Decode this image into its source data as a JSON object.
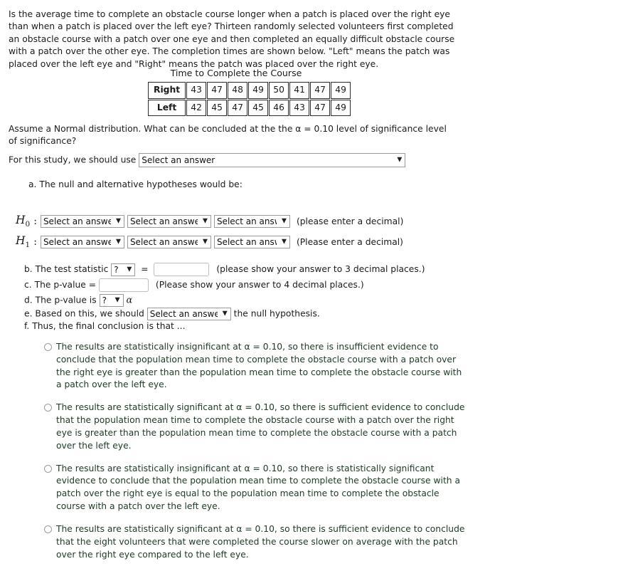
{
  "question": {
    "intro": "Is the average time to complete an obstacle course longer when a patch is placed over the right eye than when a patch is placed over the left eye? Thirteen randomly selected volunteers first completed an obstacle course with a patch over one eye and then completed an equally difficult obstacle course with a patch over the other eye. The completion times are shown below. \"Left\" means the patch was placed over the left eye and \"Right\" means the patch was placed over the right eye.",
    "assume": "Assume a Normal distribution.  What can be concluded at the the α = 0.10 level of significance level of significance?"
  },
  "table": {
    "title": "Time to Complete the Course",
    "rows": [
      {
        "label": "Right",
        "values": [
          "43",
          "47",
          "48",
          "49",
          "50",
          "41",
          "47",
          "49"
        ]
      },
      {
        "label": "Left",
        "values": [
          "42",
          "45",
          "47",
          "45",
          "46",
          "43",
          "47",
          "49"
        ]
      }
    ]
  },
  "study": {
    "prompt": "For this study, we should use",
    "select_value": "Select an answer"
  },
  "part_a": {
    "label": "a. The null and alternative hypotheses would be:",
    "h0": {
      "symbol": "H",
      "subscript": "0",
      "colon": ":",
      "select1": "Select an answer",
      "select2": "Select an answer",
      "select3": "Select an answer",
      "note": "(please enter a decimal)"
    },
    "h1": {
      "symbol": "H",
      "subscript": "1",
      "colon": ":",
      "select1": "Select an answer",
      "select2": "Select an answer",
      "select3": "Select an answer",
      "note": "(Please enter a decimal)"
    }
  },
  "part_b": {
    "label": "b. The test statistic",
    "select_value": "?",
    "equals": "=",
    "input_value": "",
    "input_placeholder": "",
    "note": "(please show your answer to 3 decimal places.)"
  },
  "part_c": {
    "label": "c. The p-value =",
    "input_value": "",
    "input_placeholder": "",
    "note": "(Please show your answer to 4 decimal places.)"
  },
  "part_d": {
    "label": "d. The p-value is",
    "select_value": "?",
    "alpha": "α"
  },
  "part_e": {
    "label_before": "e. Based on this, we should",
    "select_value": "Select an answer",
    "label_after": "the null hypothesis."
  },
  "part_f": {
    "label": "f. Thus, the final conclusion is that ..."
  },
  "options": [
    {
      "id": "option-1",
      "selected": false,
      "text": "The results are statistically insignificant at α = 0.10, so there is insufficient evidence to conclude that the population mean time to complete the obstacle course with a patch over the right eye is greater than the population mean time to complete the obstacle course with a patch over the left eye."
    },
    {
      "id": "option-2",
      "selected": false,
      "text": "The results are statistically significant at α = 0.10, so there is sufficient evidence to conclude that the population mean time to complete the obstacle course with a patch over the right eye is greater than the population mean time to complete the obstacle course with a patch over the left eye."
    },
    {
      "id": "option-3",
      "selected": false,
      "text": "The results are statistically insignificant at α = 0.10, so there is statistically significant evidence to conclude that the population mean time to complete the obstacle course with a patch over the right eye is equal to the population mean time to complete the obstacle course with a patch over the left eye."
    },
    {
      "id": "option-4",
      "selected": false,
      "text": "The results are statistically significant at α = 0.10, so there is sufficient evidence to conclude that the eight volunteers that were completed the course slower on average with the patch over the right eye compared to the left eye."
    }
  ],
  "icons": {
    "chevron_down": "⌄",
    "chevron_glyph": "▾"
  },
  "colors": {
    "text": "#1b1b1b",
    "option_text": "#1d3a25",
    "border": "#2b2b2b",
    "control_border": "#9a9a9a"
  }
}
